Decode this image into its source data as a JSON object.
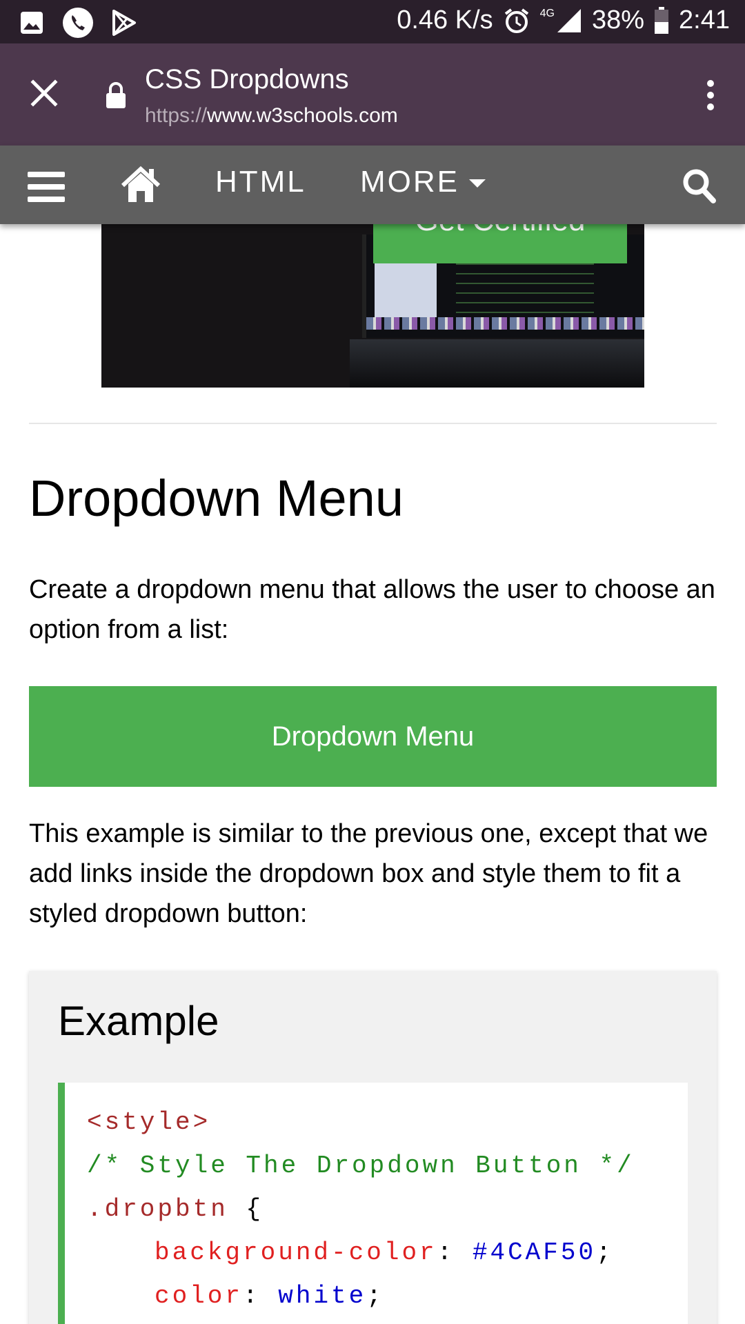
{
  "status_bar": {
    "icons_left": [
      "image-icon",
      "phone-icon",
      "play-store-icon"
    ],
    "net_speed": "0.46 K/s",
    "network_type": "4G",
    "battery": "38%",
    "time": "2:41"
  },
  "toolbar": {
    "title": "CSS Dropdowns",
    "url_scheme": "https://",
    "url_host": "www.w3schools.com"
  },
  "nav": {
    "html_label": "HTML",
    "more_label": "MORE"
  },
  "banner": {
    "text": "Get Certified"
  },
  "content": {
    "heading": "Dropdown Menu",
    "intro": "Create a dropdown menu that allows the user to choose an option from a list:",
    "button_label": "Dropdown Menu",
    "description": "This example is similar to the previous one, except that we add links inside the dropdown box and style them to fit a styled dropdown button:"
  },
  "example": {
    "title": "Example",
    "code": {
      "line1": "<style>",
      "line2": "/* Style The Dropdown Button */",
      "line3_sel": ".dropbtn",
      "line3_brace": " {",
      "line4_prop": "background-color",
      "line4_val": "#4CAF50",
      "line5_prop": "color",
      "line5_val": "white"
    }
  },
  "colors": {
    "status_bar": "#2a1f2b",
    "toolbar": "#4d384d",
    "navbar": "#5f5f5f",
    "accent_green": "#4caf50"
  }
}
